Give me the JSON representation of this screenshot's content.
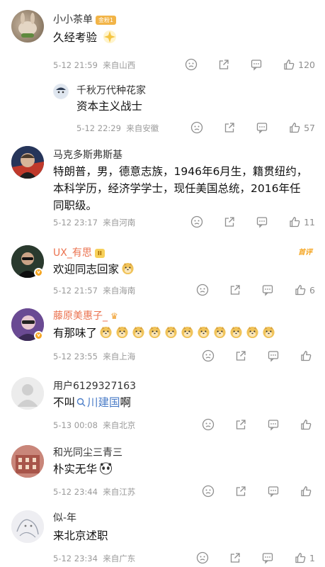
{
  "comments": [
    {
      "name": "小小茶单",
      "badge": "金粉1",
      "content": "久经考验",
      "time": "5-12 21:59",
      "location": "来自山西",
      "likes": "120"
    },
    {
      "name": "千秋万代种花家",
      "content": "资本主义战士",
      "time": "5-12 22:29",
      "location": "来自安徽",
      "likes": "57"
    },
    {
      "name": "马克多斯弗斯基",
      "content_lines": [
        "特朗普，男，德意志族，1946年6月生，籍贯纽约，",
        "本科学历，经济学学士，现任美国总统，2016年任",
        "同职级。"
      ],
      "time": "5-12 23:17",
      "location": "来自河南",
      "likes": "11"
    },
    {
      "name": "UX_有思",
      "level": "II",
      "tag": "首评",
      "content": "欢迎同志回家",
      "time": "5-12 21:57",
      "location": "来自海南",
      "likes": "6"
    },
    {
      "name": "藤原美惠子_",
      "content": "有那味了",
      "time": "5-12 23:55",
      "location": "来自上海",
      "likes": ""
    },
    {
      "name": "用户6129327163",
      "content_pre": "不叫",
      "content_link": "川建国",
      "content_post": "啊",
      "time": "5-13 00:08",
      "location": "来自北京",
      "likes": ""
    },
    {
      "name": "和光同尘三青三",
      "content": "朴实无华",
      "time": "5-12 23:44",
      "location": "来自江苏",
      "likes": ""
    },
    {
      "name": "似-年",
      "content": "来北京述职",
      "time": "5-12 23:34",
      "location": "来自广东",
      "likes": "1"
    }
  ]
}
